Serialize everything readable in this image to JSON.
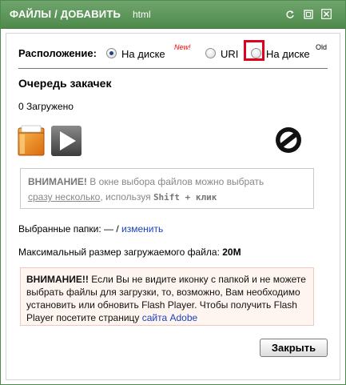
{
  "window": {
    "title": "ФАЙЛЫ / ДОБАВИТЬ",
    "subtitle": "html",
    "controls": [
      "refresh-icon",
      "maximize-icon",
      "close-icon"
    ]
  },
  "location": {
    "label": "Расположение:",
    "options": [
      {
        "label": "На диске",
        "superscript": "New!",
        "checked": true
      },
      {
        "label": "URI",
        "checked": false
      },
      {
        "label": "На диске",
        "superscript": "Old",
        "checked": false
      }
    ]
  },
  "queue": {
    "title": "Очередь закачек",
    "loaded_text": "0 Загружено",
    "icons": [
      "folder-icon",
      "play-icon",
      "cancel-icon"
    ]
  },
  "notice1": {
    "bold": "ВНИМАНИЕ!",
    "text1": " В окне выбора файлов можно выбрать",
    "underlined": "сразу несколько",
    "text2": ", используя ",
    "shortcut": "Shift + клик"
  },
  "folders": {
    "label": "Выбранные папки: —  / ",
    "link": "изменить"
  },
  "max_size": {
    "label": "Максимальный размер загружаемого файла: ",
    "value": "20M"
  },
  "notice2": {
    "bold": "ВНИМАНИЕ!!",
    "text": " Если Вы не видите иконку с папкой и не можете выбрать файлы для загрузки, то, возможно, Вам необходимо установить или обновить Flash Player. Чтобы получить Flash Player посетите страницу ",
    "link": "сайта Adobe"
  },
  "buttons": {
    "close": "Закрыть"
  },
  "colors": {
    "titlebar": "#5a965a",
    "highlight": "#e0001b",
    "link": "#1b3fbf"
  }
}
